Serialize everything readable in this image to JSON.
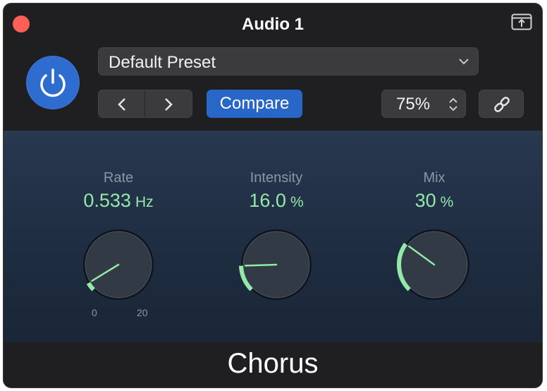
{
  "window": {
    "title": "Audio 1"
  },
  "header": {
    "preset": "Default Preset",
    "compare_label": "Compare",
    "zoom": "75%"
  },
  "knobs": [
    {
      "label": "Rate",
      "value": "0.533",
      "unit": "Hz",
      "fraction": 0.05,
      "range_min": "0",
      "range_max": "20"
    },
    {
      "label": "Intensity",
      "value": "16.0",
      "unit": "%",
      "fraction": 0.16
    },
    {
      "label": "Mix",
      "value": "30",
      "unit": "%",
      "fraction": 0.3
    }
  ],
  "footer": {
    "plugin_name": "Chorus"
  },
  "colors": {
    "accent_blue": "#2e6cd0",
    "knob_value_green": "#94e8a8",
    "close_red": "#ff5f57"
  },
  "icons": {
    "close": "close-icon",
    "share": "share-icon",
    "power": "power-icon",
    "preset_dropdown": "chevron-down-icon",
    "prev": "chevron-left-icon",
    "next": "chevron-right-icon",
    "zoom_stepper": "up-down-stepper-icon",
    "link": "link-icon"
  }
}
